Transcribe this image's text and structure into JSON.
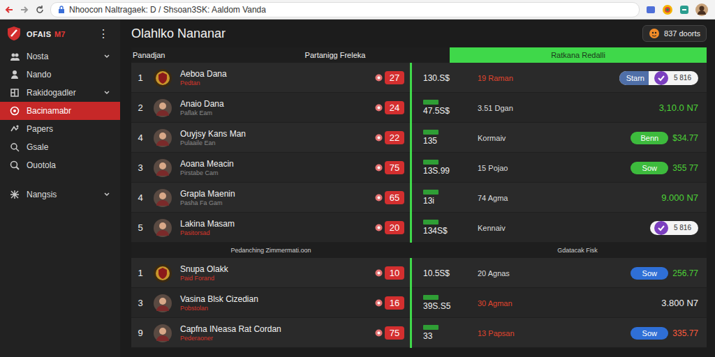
{
  "browser": {
    "address": "Nhoocon  Naltragaek: D / Shsoan3SK: Aaldom Vanda"
  },
  "sidebar": {
    "logo_text": "OFAIS",
    "logo_badge": "M7",
    "menu_icon": "⋮",
    "items": [
      {
        "label": "Nosta",
        "expandable": true,
        "selected": false
      },
      {
        "label": "Nando",
        "expandable": false,
        "selected": false
      },
      {
        "label": "Rakidogadler",
        "expandable": true,
        "selected": false
      },
      {
        "label": "Bacinamabr",
        "expandable": false,
        "selected": true
      },
      {
        "label": "Papers",
        "expandable": false,
        "selected": false
      },
      {
        "label": "Gsale",
        "expandable": false,
        "selected": false
      },
      {
        "label": "Ouotola",
        "expandable": false,
        "selected": false
      },
      {
        "label": "Nangsis",
        "expandable": true,
        "selected": false
      }
    ]
  },
  "page": {
    "title": "Olahlko Nananar",
    "badge": "837 doorts"
  },
  "table": {
    "columns": [
      "Panadjan",
      "Partanigg Freleka",
      "Ratkana Redalli"
    ],
    "sections": [
      {
        "caption": [],
        "rows": [
          {
            "rank": "1",
            "avatar_kind": "crest",
            "name": "Aeboa Dana",
            "sub": "Pedtan",
            "sub_color": "#d9362b",
            "score": "27",
            "tag": false,
            "amount": "130.S$",
            "mid": "19 Raman",
            "mid_color": "#e0452e",
            "action": {
              "kind": "toggle",
              "label": "Starn",
              "value": "5 816",
              "on": true
            }
          },
          {
            "rank": "2",
            "avatar_kind": "person",
            "name": "Anaio Dana",
            "sub": "Paflak Eam",
            "sub_color": "#8a8a8a",
            "score": "24",
            "tag": true,
            "amount": "47.5S$",
            "mid": "3.51 Dgan",
            "mid_color": "#dddddd",
            "action": {
              "kind": "amount",
              "value": "3,10.0 N7",
              "color": "#4cd137"
            }
          },
          {
            "rank": "4",
            "avatar_kind": "person",
            "name": "Ouyjsy Kans Man",
            "sub": "Pulaaile Ean",
            "sub_color": "#8a8a8a",
            "score": "22",
            "tag": true,
            "amount": "135",
            "mid": "Kormaiv",
            "mid_color": "#dddddd",
            "action": {
              "kind": "pill",
              "label": "Benn",
              "pill_color": "#3dbb3d",
              "value": "$34.77",
              "color": "#4cd137"
            }
          },
          {
            "rank": "3",
            "avatar_kind": "person",
            "name": "Aoana Meacin",
            "sub": "Pirstabe Cam",
            "sub_color": "#8a8a8a",
            "score": "75",
            "tag": true,
            "amount": "13S.99",
            "mid": "15 Pojao",
            "mid_color": "#dddddd",
            "action": {
              "kind": "pill",
              "label": "Sow",
              "pill_color": "#3dbb3d",
              "value": "355 77",
              "color": "#4cd137"
            }
          },
          {
            "rank": "4",
            "avatar_kind": "person",
            "name": "Grapla Maenin",
            "sub": "Pasha Fa Gam",
            "sub_color": "#8a8a8a",
            "score": "65",
            "tag": true,
            "amount": "13i",
            "mid": "74 Agma",
            "mid_color": "#dddddd",
            "action": {
              "kind": "amount",
              "value": "9.000 N7",
              "color": "#4cd137"
            }
          },
          {
            "rank": "5",
            "avatar_kind": "person",
            "name": "Lakina Masam",
            "sub": "Pasitorsad",
            "sub_color": "#d9362b",
            "score": "20",
            "tag": true,
            "amount": "134S$",
            "mid": "Kennaiv",
            "mid_color": "#dddddd",
            "action": {
              "kind": "toggle",
              "label": "",
              "value": "5 816",
              "on": true
            }
          }
        ]
      },
      {
        "caption": [
          "Pedanching Zimmermati.oon",
          "Gdatacak Fisk"
        ],
        "rows": [
          {
            "rank": "1",
            "avatar_kind": "crest",
            "name": "Snupa Olakk",
            "sub": "Paid Forand",
            "sub_color": "#d9362b",
            "score": "10",
            "tag": false,
            "amount": "10.5S$",
            "mid": "20 Agnas",
            "mid_color": "#dddddd",
            "action": {
              "kind": "pill",
              "label": "Sow",
              "pill_color": "#2f6fd6",
              "value": "256.77",
              "color": "#4cd137"
            }
          },
          {
            "rank": "3",
            "avatar_kind": "person",
            "name": "Vasina Blsk Cizedian",
            "sub": "Pobstolan",
            "sub_color": "#d9362b",
            "score": "16",
            "tag": true,
            "amount": "39S.S5",
            "mid": "30 Agman",
            "mid_color": "#e0452e",
            "action": {
              "kind": "amount",
              "value": "3.800 N7",
              "color": "#f0f0f0"
            }
          },
          {
            "rank": "9",
            "avatar_kind": "person",
            "name": "Capfna INeasa Rat Cordan",
            "sub": "Pederaoner",
            "sub_color": "#d9362b",
            "score": "75",
            "tag": true,
            "amount": "33",
            "mid": "13 Papsan",
            "mid_color": "#e0452e",
            "action": {
              "kind": "pill",
              "label": "Sow",
              "pill_color": "#2f6fd6",
              "value": "335.77",
              "color": "#ff5a3c"
            }
          }
        ]
      }
    ]
  }
}
